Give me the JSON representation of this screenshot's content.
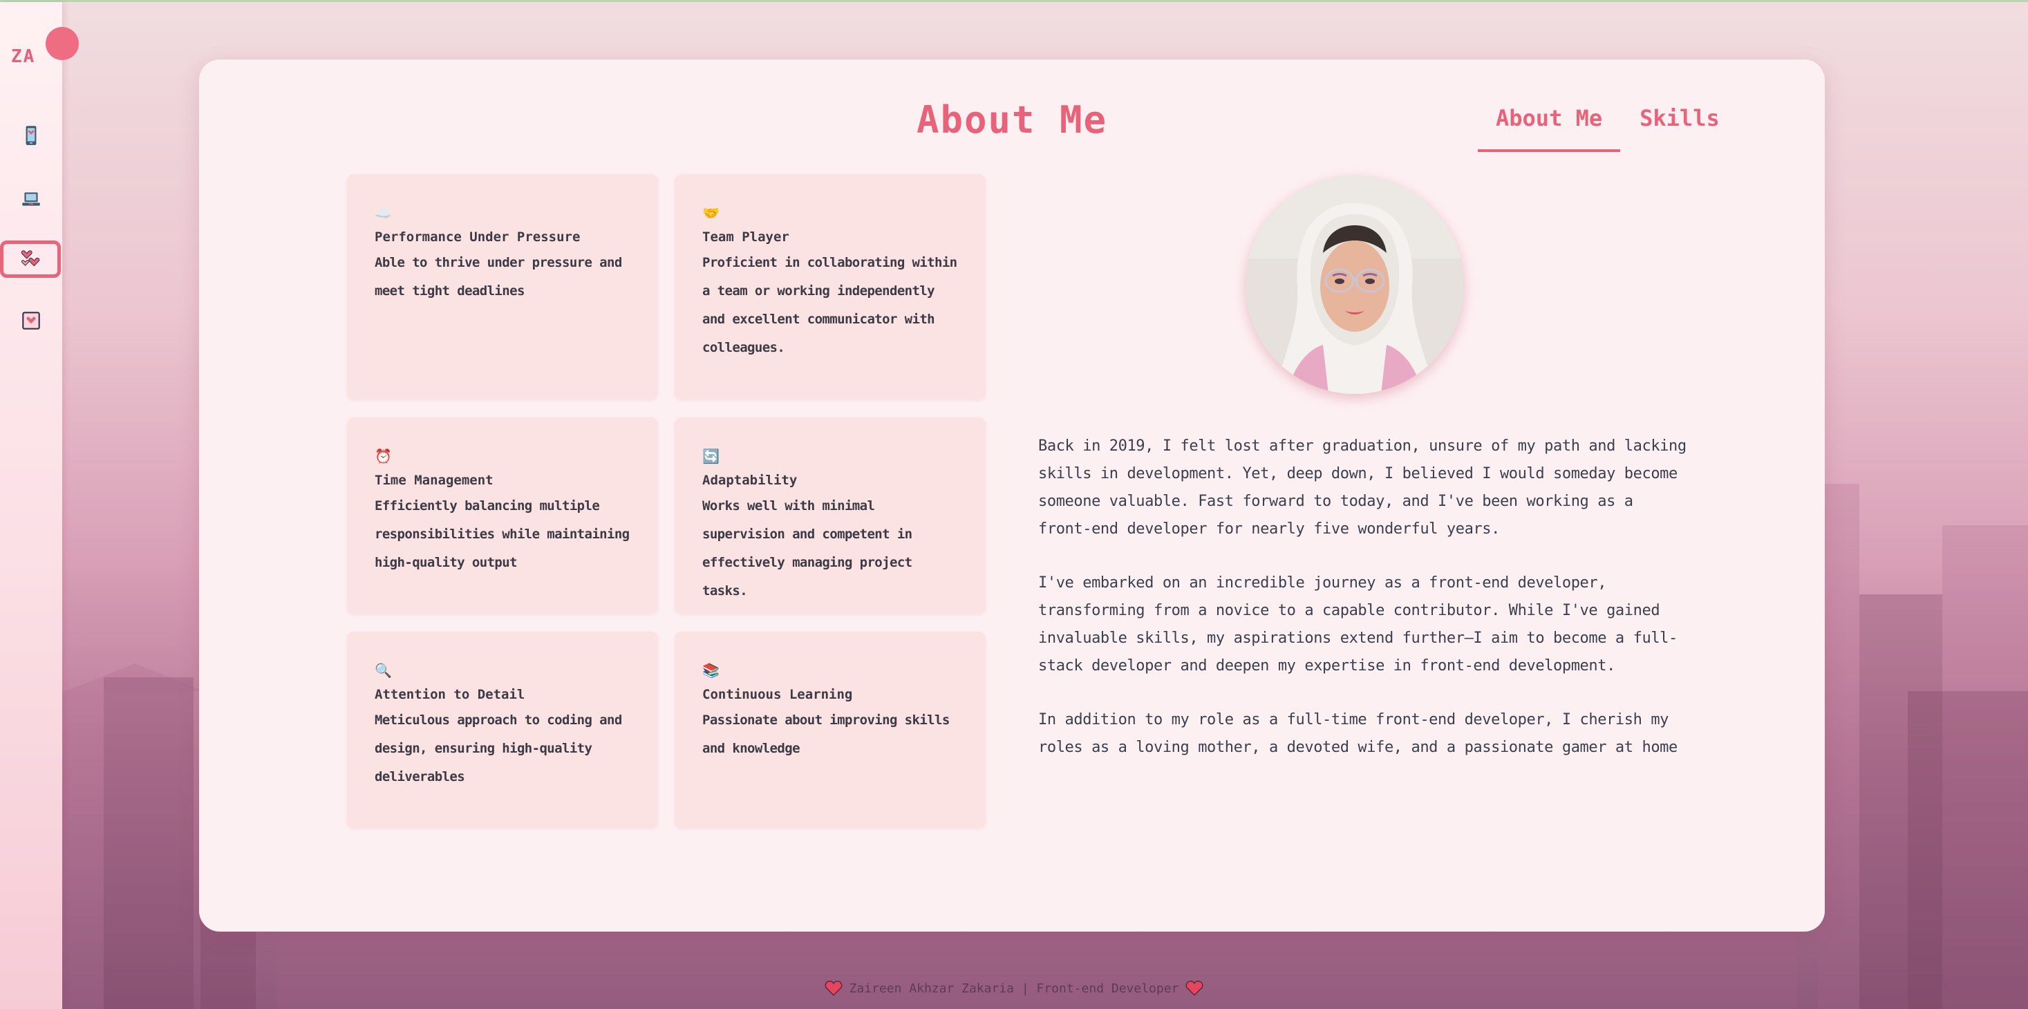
{
  "sidebar": {
    "logo": "ZA",
    "items": [
      {
        "name": "phone-icon"
      },
      {
        "name": "laptop-icon"
      },
      {
        "name": "hearts-icon",
        "active": true
      },
      {
        "name": "heart-frame-icon"
      }
    ]
  },
  "card": {
    "title": "About Me",
    "tabs": [
      {
        "label": "About Me",
        "active": true
      },
      {
        "label": "Skills",
        "active": false
      }
    ],
    "traits": [
      {
        "icon": "☁️",
        "title": "Performance Under Pressure",
        "desc": "Able to thrive under pressure and meet tight deadlines"
      },
      {
        "icon": "🤝",
        "title": "Team Player",
        "desc": "Proficient in collaborating within a team or working independently and excellent communicator with colleagues."
      },
      {
        "icon": "⏰",
        "title": "Time Management",
        "desc": "Efficiently balancing multiple responsibilities while maintaining high-quality output"
      },
      {
        "icon": "🔄",
        "title": "Adaptability",
        "desc": "Works well with minimal supervision and competent in effectively managing project tasks."
      },
      {
        "icon": "🔍",
        "title": "Attention to Detail",
        "desc": "Meticulous approach to coding and design, ensuring high-quality deliverables"
      },
      {
        "icon": "📚",
        "title": "Continuous Learning",
        "desc": "Passionate about improving skills and knowledge"
      }
    ],
    "about": [
      "Back in 2019, I felt lost after graduation, unsure of my path and lacking skills in development. Yet, deep down, I believed I would someday become someone valuable. Fast forward to today, and I've been working as a front-end developer for nearly five wonderful years.",
      "I've embarked on an incredible journey as a front-end developer, transforming from a novice to a capable contributor. While I've gained invaluable skills, my aspirations extend further—I aim to become a full-stack developer and deepen my expertise in front-end development.",
      "In addition to my role as a full-time front-end developer, I cherish my roles as a loving mother, a devoted wife, and a passionate gamer at home"
    ]
  },
  "footer": {
    "text": "Zaireen Akhzar Zakaria | Front-end Developer"
  },
  "colors": {
    "accent": "#e8637a",
    "card_bg": "#fdf0f3",
    "trait_bg": "#fbe3e3"
  }
}
